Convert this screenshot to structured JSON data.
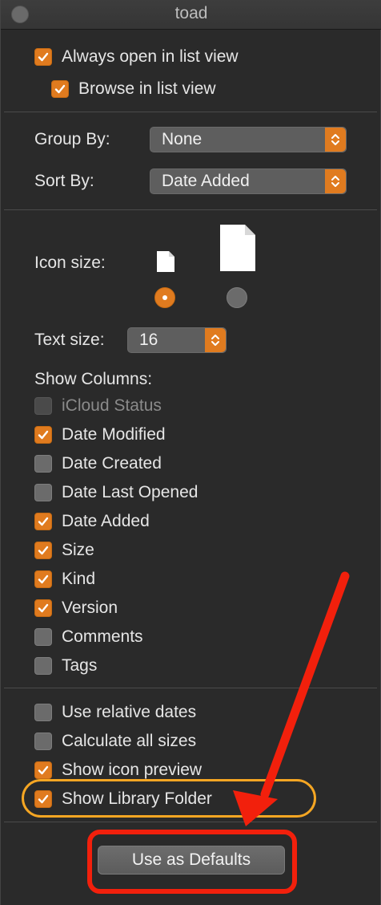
{
  "window": {
    "title": "toad"
  },
  "top_options": [
    {
      "label": "Always open in list view",
      "checked": true
    },
    {
      "label": "Browse in list view",
      "checked": true
    }
  ],
  "group_by": {
    "label": "Group By:",
    "value": "None"
  },
  "sort_by": {
    "label": "Sort By:",
    "value": "Date Added"
  },
  "icon_size": {
    "label": "Icon size:",
    "selected": "small"
  },
  "text_size": {
    "label": "Text size:",
    "value": "16"
  },
  "show_columns": {
    "label": "Show Columns:",
    "items": [
      {
        "label": "iCloud Status",
        "checked": false,
        "disabled": true
      },
      {
        "label": "Date Modified",
        "checked": true
      },
      {
        "label": "Date Created",
        "checked": false
      },
      {
        "label": "Date Last Opened",
        "checked": false
      },
      {
        "label": "Date Added",
        "checked": true
      },
      {
        "label": "Size",
        "checked": true
      },
      {
        "label": "Kind",
        "checked": true
      },
      {
        "label": "Version",
        "checked": true
      },
      {
        "label": "Comments",
        "checked": false
      },
      {
        "label": "Tags",
        "checked": false
      }
    ]
  },
  "bottom_options": [
    {
      "label": "Use relative dates",
      "checked": false
    },
    {
      "label": "Calculate all sizes",
      "checked": false
    },
    {
      "label": "Show icon preview",
      "checked": true
    },
    {
      "label": "Show Library Folder",
      "checked": true
    }
  ],
  "defaults_button": {
    "label": "Use as Defaults"
  },
  "colors": {
    "accent": "#e07b1f",
    "annotation_red": "#f2200c",
    "annotation_orange": "#f5a623"
  }
}
